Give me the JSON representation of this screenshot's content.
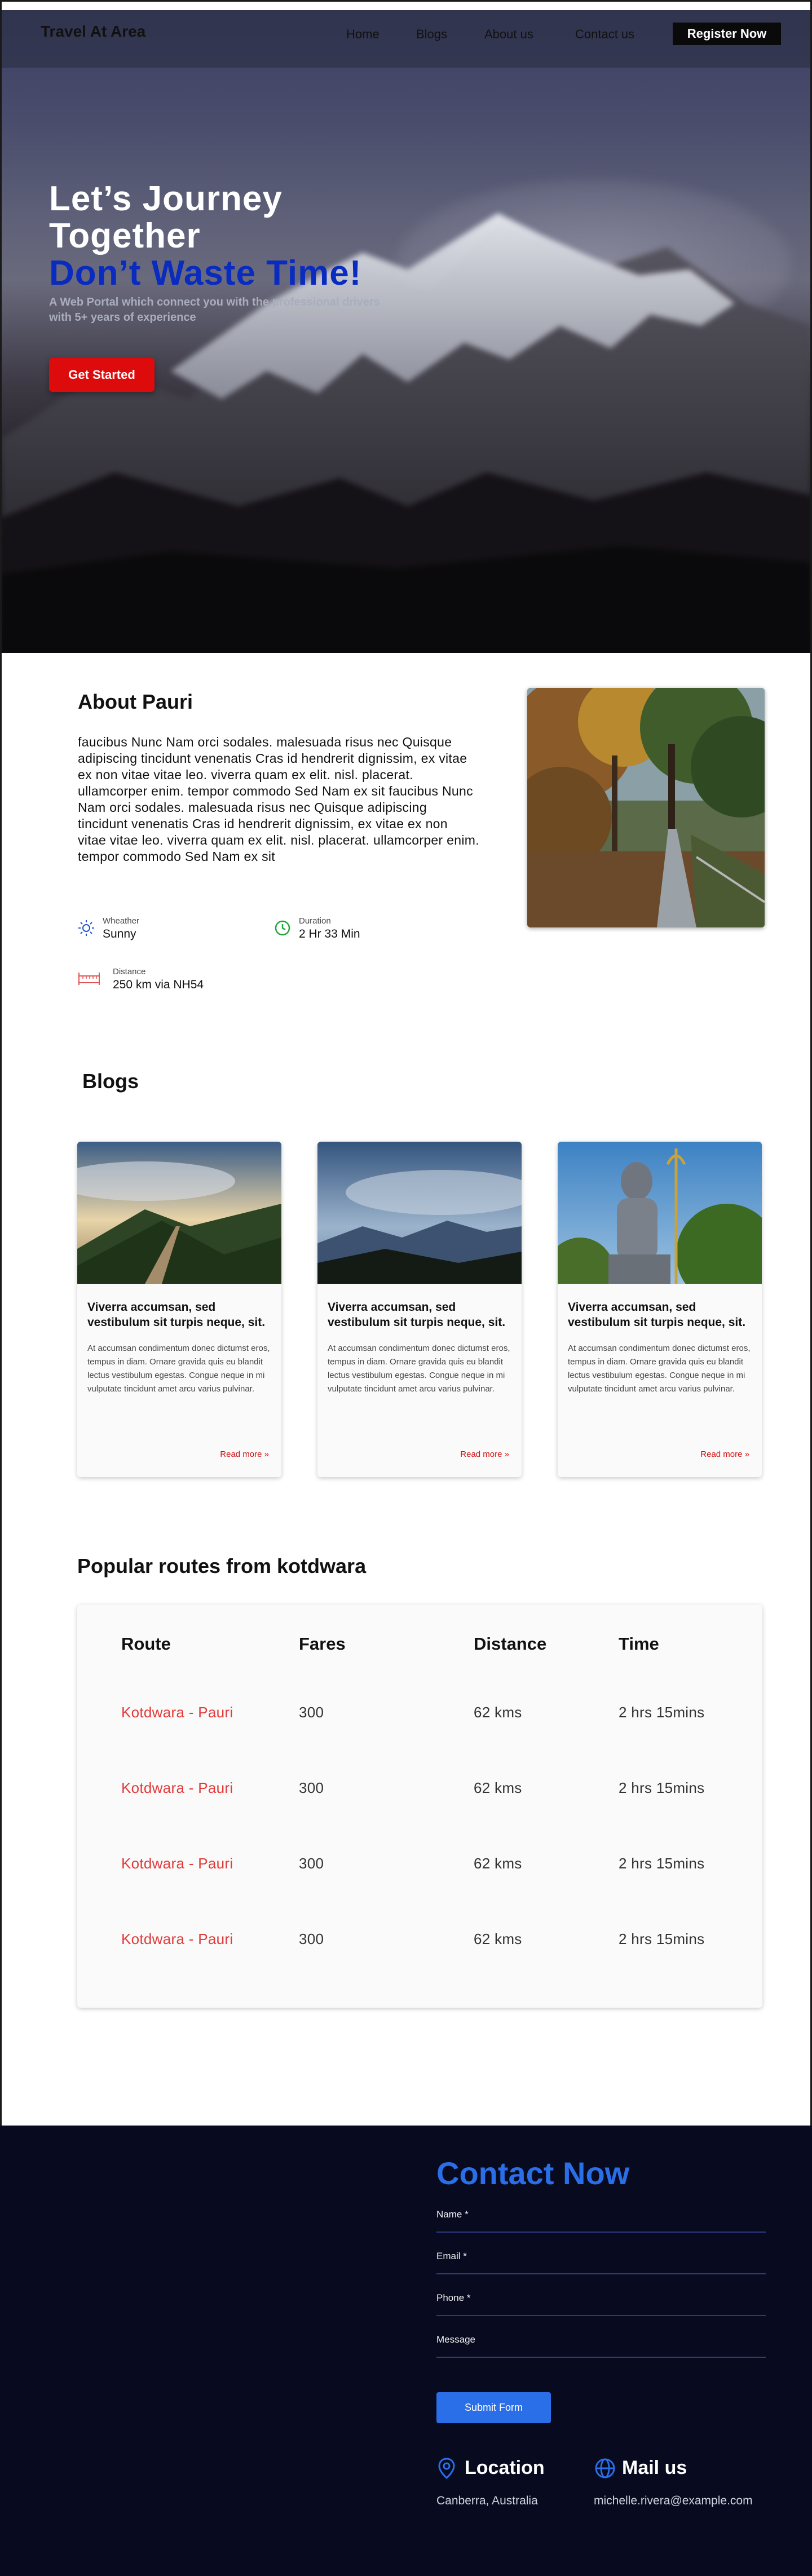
{
  "nav": {
    "brand": "Travel At Area",
    "items": [
      "Home",
      "Blogs",
      "About us",
      "Contact us"
    ],
    "cta": "Register Now"
  },
  "hero": {
    "title_line1": "Let’s Journey",
    "title_line2": "Together",
    "subtitle": "Don’t Waste Time!",
    "description": "A Web Portal which connect you with the professional drivers with 5+ years of experience",
    "button": "Get Started"
  },
  "about": {
    "title": "About Pauri",
    "text": "faucibus Nunc Nam orci sodales. malesuada risus nec Quisque adipiscing tincidunt venenatis Cras id hendrerit dignissim, ex vitae ex non vitae vitae leo. viverra quam ex elit. nisl. placerat. ullamcorper enim. tempor commodo Sed Nam ex sit faucibus Nunc Nam orci sodales. malesuada risus nec Quisque adipiscing tincidunt venenatis Cras id hendrerit dignissim, ex vitae ex non vitae vitae leo. viverra quam ex elit. nisl. placerat. ullamcorper enim. tempor commodo Sed Nam ex sit",
    "weather_label": "Wheather",
    "weather_value": "Sunny",
    "duration_label": "Duration",
    "duration_value": "2 Hr 33 Min",
    "distance_label": "Distance",
    "distance_value": "250 km via NH54"
  },
  "blogs": {
    "title": "Blogs",
    "cards": [
      {
        "title": "Viverra accumsan, sed vestibulum sit turpis neque, sit.",
        "excerpt": "At accumsan condimentum donec dictumst eros, tempus in diam. Ornare gravida quis eu blandit lectus vestibulum egestas. Congue neque in mi vulputate tincidunt amet arcu varius pulvinar.",
        "more": "Read more »"
      },
      {
        "title": "Viverra accumsan, sed vestibulum sit turpis neque, sit.",
        "excerpt": "At accumsan condimentum donec dictumst eros, tempus in diam. Ornare gravida quis eu blandit lectus vestibulum egestas. Congue neque in mi vulputate tincidunt amet arcu varius pulvinar.",
        "more": "Read more »"
      },
      {
        "title": "Viverra accumsan, sed vestibulum sit turpis neque, sit.",
        "excerpt": "At accumsan condimentum donec dictumst eros, tempus in diam. Ornare gravida quis eu blandit lectus vestibulum egestas. Congue neque in mi vulputate tincidunt amet arcu varius pulvinar.",
        "more": "Read more »"
      }
    ]
  },
  "routes": {
    "title": "Popular routes from kotdwara",
    "headers": [
      "Route",
      "Fares",
      "Distance",
      "Time"
    ],
    "rows": [
      [
        "Kotdwara - Pauri",
        "300",
        "62 kms",
        "2 hrs 15mins"
      ],
      [
        "Kotdwara - Pauri",
        "300",
        "62 kms",
        "2 hrs 15mins"
      ],
      [
        "Kotdwara - Pauri",
        "300",
        "62 kms",
        "2 hrs 15mins"
      ],
      [
        "Kotdwara - Pauri",
        "300",
        "62 kms",
        "2 hrs 15mins"
      ]
    ]
  },
  "contact": {
    "title": "Contact Now",
    "fields": [
      "Name *",
      "Email *",
      "Phone *",
      "Message"
    ],
    "submit": "Submit Form",
    "location_head": "Location",
    "location_value": "Canberra, Australia",
    "mail_head": "Mail us",
    "mail_value": "michelle.rivera@example.com"
  },
  "colors": {
    "accent_red": "#dd0b0b",
    "hero_blue": "#0a2bbf",
    "contact_blue": "#2a6ee8",
    "footer_bg": "#080b1f"
  }
}
